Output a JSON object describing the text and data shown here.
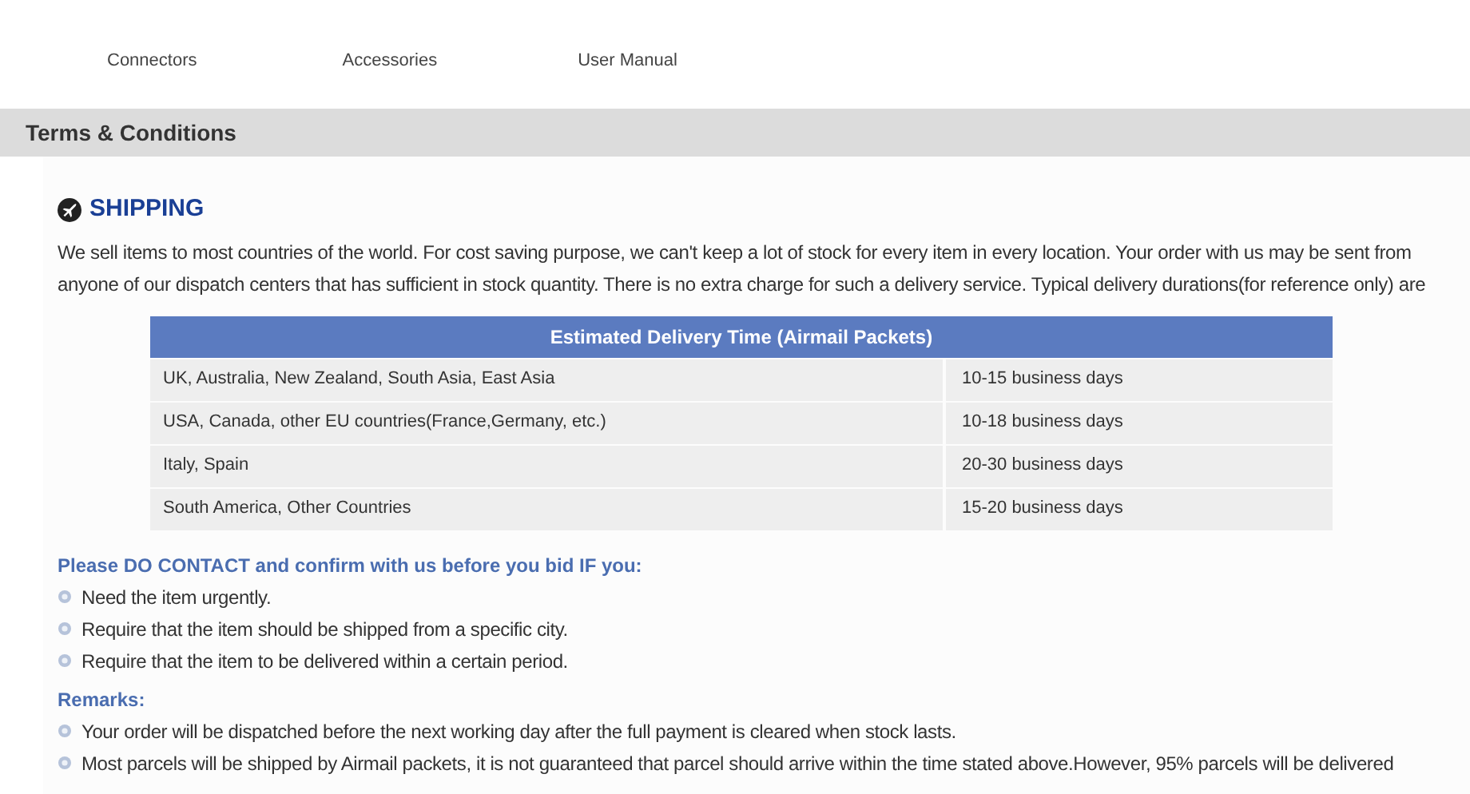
{
  "nav": [
    "Connectors",
    "Accessories",
    "User Manual"
  ],
  "section_bar": {
    "title": "Terms & Conditions"
  },
  "shipping": {
    "title": "SHIPPING",
    "intro_lines": [
      "We sell items to most countries of the world. For cost saving purpose, we can't keep a lot of stock for every item in every location. Your order with us may be sent from",
      "anyone of our dispatch centers that has sufficient in stock quantity. There is no extra charge for such a delivery service. Typical delivery durations(for reference only) are"
    ],
    "table": {
      "title": "Estimated Delivery Time (Airmail Packets)",
      "rows": [
        [
          "UK, Australia, New Zealand, South Asia, East Asia",
          "10-15 business days"
        ],
        [
          "USA, Canada, other EU countries(France,Germany, etc.)",
          "10-18 business days"
        ],
        [
          "Italy, Spain",
          "20-30 business days"
        ],
        [
          "South America, Other Countries",
          "15-20 business days"
        ]
      ]
    },
    "contact": {
      "title": "Please DO CONTACT and confirm with us before you bid IF you:",
      "items": [
        "Need the item urgently.",
        "Require that the item should be shipped from a specific city.",
        "Require that the item to be delivered within a certain period."
      ]
    },
    "remarks": {
      "title": "Remarks:",
      "items": [
        "Your order will be dispatched before the next working day after the full payment is cleared when stock lasts.",
        "Most parcels will be shipped by Airmail packets, it is not guaranteed that parcel should arrive within the time stated above.However, 95% parcels will be delivered"
      ]
    }
  }
}
